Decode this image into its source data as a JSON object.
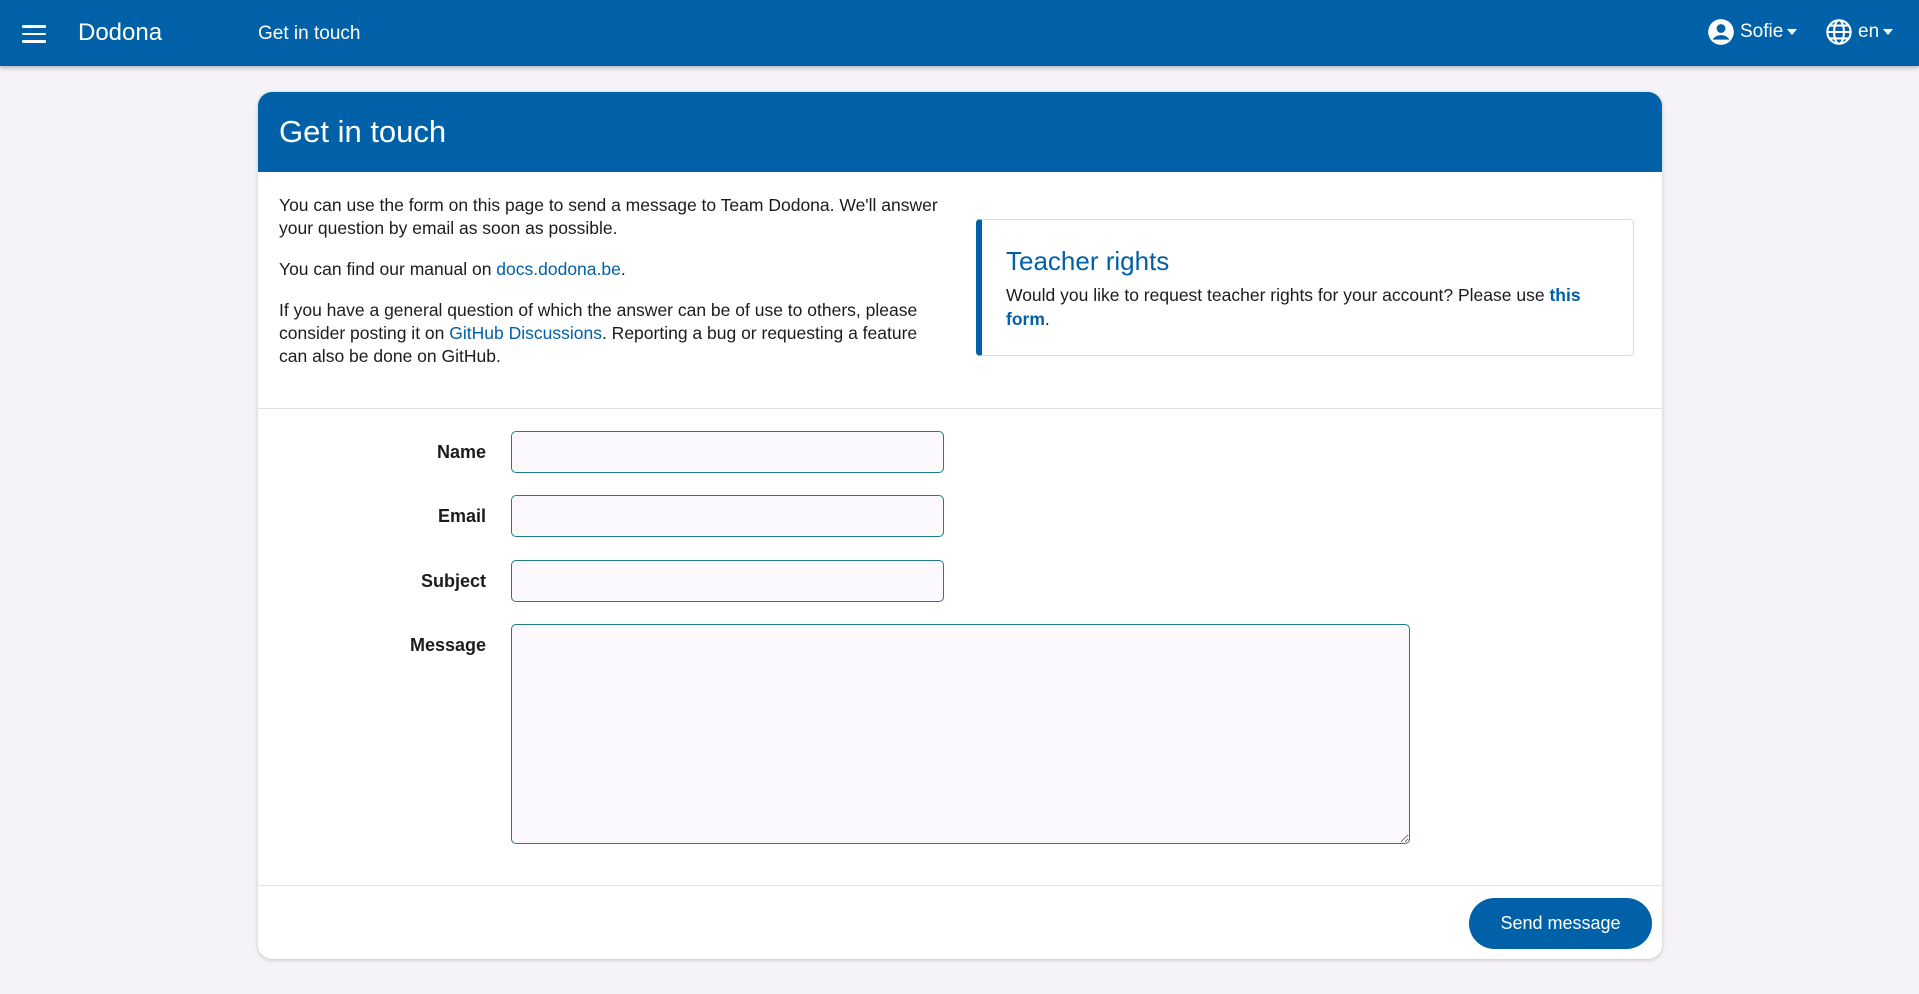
{
  "topbar": {
    "brand": "Dodona",
    "page": "Get in touch",
    "user": "Sofie",
    "language": "en",
    "icons": {
      "menu": "hamburger-menu-icon",
      "user": "account-circle-icon",
      "language": "globe-icon"
    }
  },
  "card": {
    "title": "Get in touch",
    "intro": {
      "p1": "You can use the form on this page to send a message to Team Dodona. We'll answer your question by email as soon as possible.",
      "p2_prefix": "You can find our manual on ",
      "p2_link": "docs.dodona.be",
      "p2_suffix": ".",
      "p3_prefix": "If you have a general question of which the answer can be of use to others, please consider posting it on ",
      "p3_link": "GitHub Discussions",
      "p3_suffix": ". Reporting a bug or requesting a feature can also be done on GitHub."
    },
    "callout": {
      "title": "Teacher rights",
      "text_prefix": "Would you like to request teacher rights for your account? Please use ",
      "link": "this form",
      "text_suffix": "."
    }
  },
  "form": {
    "name_label": "Name",
    "email_label": "Email",
    "subject_label": "Subject",
    "message_label": "Message",
    "name_value": "",
    "email_value": "",
    "subject_value": "",
    "message_value": ""
  },
  "actions": {
    "send_label": "Send message"
  },
  "colors": {
    "primary": "#0061a8",
    "input_border": "#1f7a8c",
    "background": "#f5f3f7"
  }
}
